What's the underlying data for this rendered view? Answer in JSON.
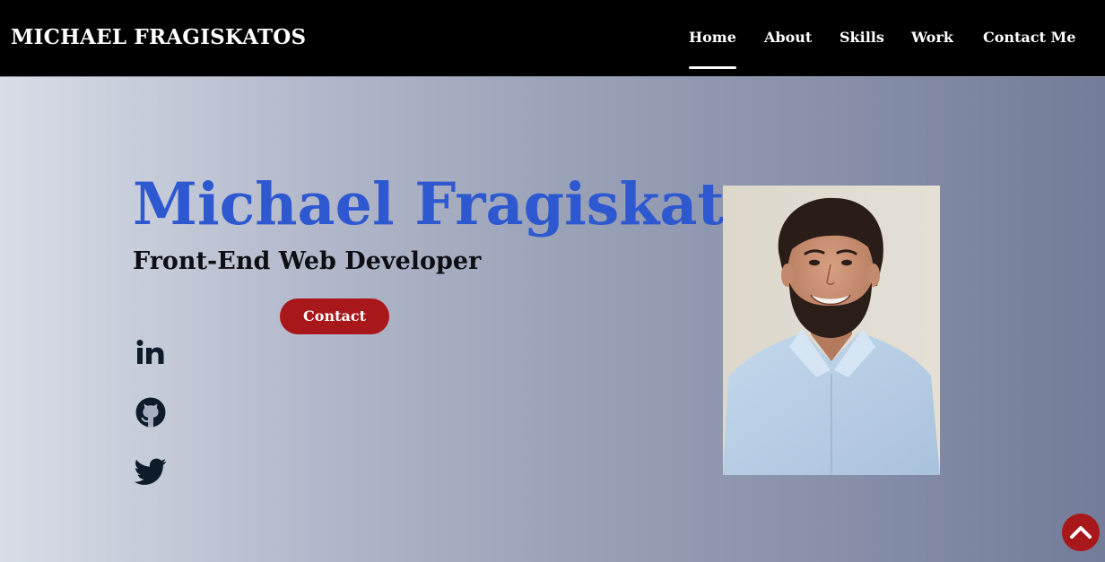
{
  "nav": {
    "brand": "MICHAEL FRAGISKATOS",
    "items": [
      {
        "label": "Home",
        "active": true
      },
      {
        "label": "About",
        "active": false
      },
      {
        "label": "Skills",
        "active": false
      },
      {
        "label": "Work",
        "active": false
      },
      {
        "label": "Contact Me",
        "active": false
      }
    ]
  },
  "hero": {
    "name": "Michael Fragiskatos",
    "title": "Front-End Web Developer",
    "contact_label": "Contact",
    "socials": [
      {
        "icon": "linkedin-icon"
      },
      {
        "icon": "github-icon"
      },
      {
        "icon": "twitter-icon"
      }
    ],
    "portrait": "profile-photo"
  },
  "scroll_top": {
    "icon": "chevron-up-icon"
  },
  "colors": {
    "name": "#2e58d0",
    "accent": "#a8171a",
    "nav_bg": "#000000",
    "social_icon": "#0d1b2a"
  }
}
